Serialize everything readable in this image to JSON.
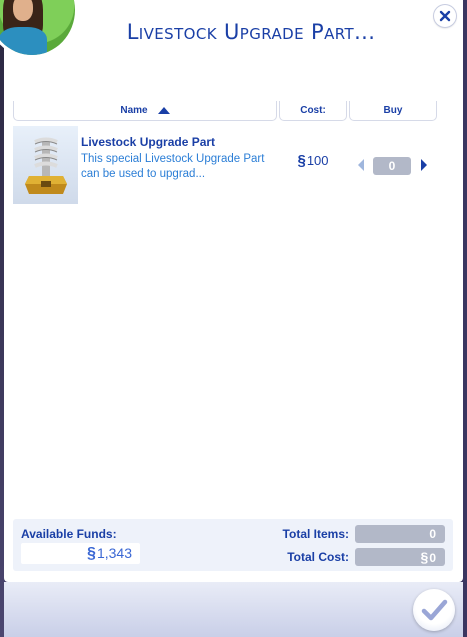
{
  "dialog": {
    "title": "Livestock Upgrade Part..."
  },
  "table": {
    "headers": {
      "name": "Name",
      "cost": "Cost:",
      "buy": "Buy"
    },
    "sort": "ascending",
    "rows": [
      {
        "name": "Livestock Upgrade Part",
        "description": "This special Livestock Upgrade Part can be used to upgrad...",
        "currency": "§",
        "price": "100",
        "quantity": "0"
      }
    ]
  },
  "summary": {
    "available_funds_label": "Available Funds:",
    "available_funds_currency": "§",
    "available_funds_value": "1,343",
    "total_items_label": "Total Items:",
    "total_items_value": "0",
    "total_cost_label": "Total Cost:",
    "total_cost_currency": "§",
    "total_cost_value": "0"
  },
  "icons": {
    "close": "close-icon",
    "confirm": "checkmark-icon",
    "sort": "sort-ascending-icon",
    "decrease": "arrow-left-icon",
    "increase": "arrow-right-icon"
  },
  "colors": {
    "accent": "#1a3fa6",
    "link_text": "#2b7ed6",
    "disabled_field": "#b2b8c8"
  }
}
